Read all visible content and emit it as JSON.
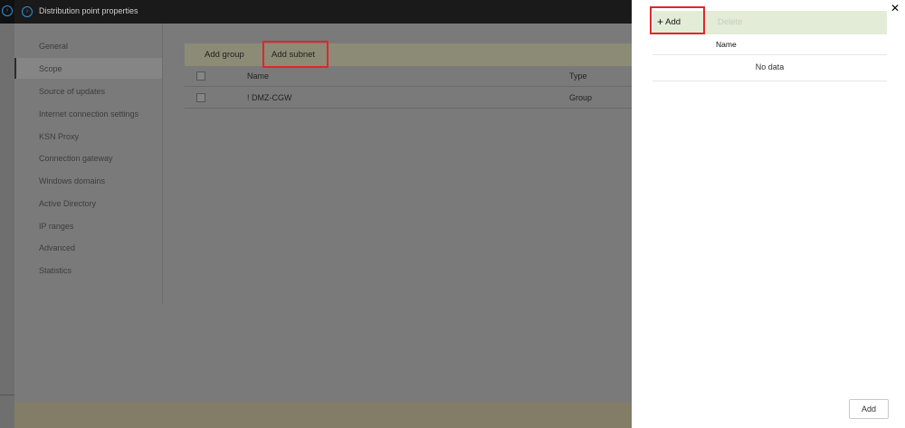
{
  "window": {
    "title": "Distribution point properties"
  },
  "nav": {
    "items": [
      {
        "label": "General"
      },
      {
        "label": "Scope"
      },
      {
        "label": "Source of updates"
      },
      {
        "label": "Internet connection settings"
      },
      {
        "label": "KSN Proxy"
      },
      {
        "label": "Connection gateway"
      },
      {
        "label": "Windows domains"
      },
      {
        "label": "Active Directory"
      },
      {
        "label": "IP ranges"
      },
      {
        "label": "Advanced"
      },
      {
        "label": "Statistics"
      }
    ],
    "active": "Scope"
  },
  "toolbar": {
    "add_group": "Add group",
    "add_subnet": "Add subnet"
  },
  "table": {
    "columns": [
      "Name",
      "Type"
    ],
    "rows": [
      {
        "name": "! DMZ-CGW",
        "type": "Group"
      }
    ]
  },
  "side_panel": {
    "add_label": "Add",
    "delete_label": "Delete",
    "column_name": "Name",
    "empty_text": "No data",
    "footer_add": "Add"
  },
  "colors": {
    "highlight": "#e0262b",
    "toolbar_bg": "#e3ecd7",
    "accent": "#2e8fd8"
  }
}
